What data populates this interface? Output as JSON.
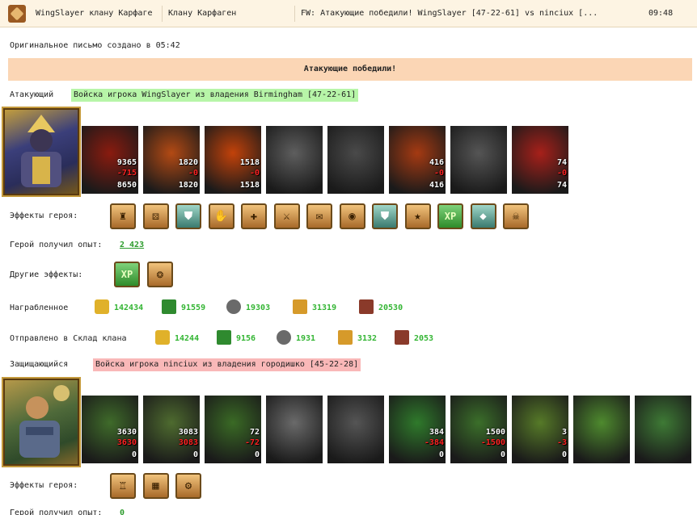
{
  "header": {
    "sender": "WingSlayer клану Карфаге",
    "recipient": "Клану Карфаген",
    "subject": "FW: Атакующие победили! WingSlayer [47-22-61] vs ninciux [...",
    "time": "09:48"
  },
  "letter_created": "Оригинальное письмо создано в 05:42",
  "banner": "Атакующие победили!",
  "attacker": {
    "label": "Атакующий",
    "army": "Войска игрока WingSlayer из владения Birmingham [47-22-61]",
    "units": [
      {
        "icon": "fire-dragon",
        "top": "9365",
        "mid": "-715",
        "bot": "8650",
        "color": "#8a1b0f"
      },
      {
        "icon": "fire-lich",
        "top": "1820",
        "mid": "-0",
        "bot": "1820",
        "color": "#b34a14"
      },
      {
        "icon": "fire-beast",
        "top": "1518",
        "mid": "-0",
        "bot": "1518",
        "color": "#c2420a"
      },
      {
        "icon": "gray-demon",
        "top": "",
        "mid": "",
        "bot": "",
        "color": "#5e5e5e"
      },
      {
        "icon": "gray-gargoyle",
        "top": "",
        "mid": "",
        "bot": "",
        "color": "#4a4a4a"
      },
      {
        "icon": "fire-warrior",
        "top": "416",
        "mid": "-0",
        "bot": "416",
        "color": "#a53a12"
      },
      {
        "icon": "gray-knight",
        "top": "",
        "mid": "",
        "bot": "",
        "color": "#555555"
      },
      {
        "icon": "fire-mage",
        "top": "74",
        "mid": "-0",
        "bot": "74",
        "color": "#a7201a"
      }
    ],
    "effects_label": "Эффекты героя:",
    "effects": [
      "helmet-icon",
      "dice-icon",
      "shield-icon",
      "handshake-icon",
      "banner-icon",
      "armor-icon",
      "scroll-icon",
      "coin-icon",
      "shield-green-icon",
      "xp-badge-icon",
      "xp-icon",
      "crystal-icon",
      "skeleton-icon"
    ],
    "exp_label": "Герой получил опыт:",
    "exp_value": "2 423",
    "other_label": "Другие эффекты:",
    "other_effects": [
      "xp-icon",
      "gold-bag-icon"
    ],
    "loot_label": "Награбленное",
    "loot": [
      {
        "icon": "gold-icon",
        "value": "142434"
      },
      {
        "icon": "wood-icon",
        "value": "91559"
      },
      {
        "icon": "ore-icon",
        "value": "19303"
      },
      {
        "icon": "wheat-icon",
        "value": "31319"
      },
      {
        "icon": "bricks-icon",
        "value": "20530"
      }
    ],
    "sent_label": "Отправлено в Склад клана",
    "sent": [
      {
        "icon": "gold-icon",
        "value": "14244"
      },
      {
        "icon": "wood-icon",
        "value": "9156"
      },
      {
        "icon": "ore-icon",
        "value": "1931"
      },
      {
        "icon": "wheat-icon",
        "value": "3132"
      },
      {
        "icon": "bricks-icon",
        "value": "2053"
      }
    ]
  },
  "defender": {
    "label": "Защищающийся",
    "army": "Войска игрока ninciux из владения городишко [45-22-28]",
    "units": [
      {
        "icon": "dwarf",
        "top": "3630",
        "mid": "3630",
        "bot": "0",
        "color": "#3f6b2a"
      },
      {
        "icon": "dwarf-warrior",
        "top": "3083",
        "mid": "3083",
        "bot": "0",
        "color": "#4e6b2f"
      },
      {
        "icon": "elf-spearman",
        "top": "72",
        "mid": "-72",
        "bot": "0",
        "color": "#3a6a25"
      },
      {
        "icon": "gray-griffin",
        "top": "",
        "mid": "",
        "bot": "",
        "color": "#6a6a6a"
      },
      {
        "icon": "gray-archer",
        "top": "",
        "mid": "",
        "bot": "",
        "color": "#555555"
      },
      {
        "icon": "dryad",
        "top": "384",
        "mid": "-384",
        "bot": "0",
        "color": "#2f7a2b"
      },
      {
        "icon": "druid",
        "top": "1500",
        "mid": "-1500",
        "bot": "0",
        "color": "#3b6f2a"
      },
      {
        "icon": "minotaur",
        "top": "3",
        "mid": "-3",
        "bot": "0",
        "color": "#567a28"
      },
      {
        "icon": "tower-orb",
        "top": "",
        "mid": "",
        "bot": "",
        "color": "#4e8a2e"
      },
      {
        "icon": "treant-tower",
        "top": "",
        "mid": "",
        "bot": "",
        "color": "#3e7a35"
      }
    ],
    "effects_label": "Эффекты героя:",
    "effects": [
      "castle-icon",
      "fort-icon",
      "catapult-icon"
    ],
    "exp_label": "Герой получил опыт:",
    "exp_value": "0"
  },
  "colors": {
    "attacker_tag": "#b7f5a8",
    "defender_tag": "#f9b8b8",
    "banner": "#fbd6b5",
    "resource_value": "#33b533"
  }
}
